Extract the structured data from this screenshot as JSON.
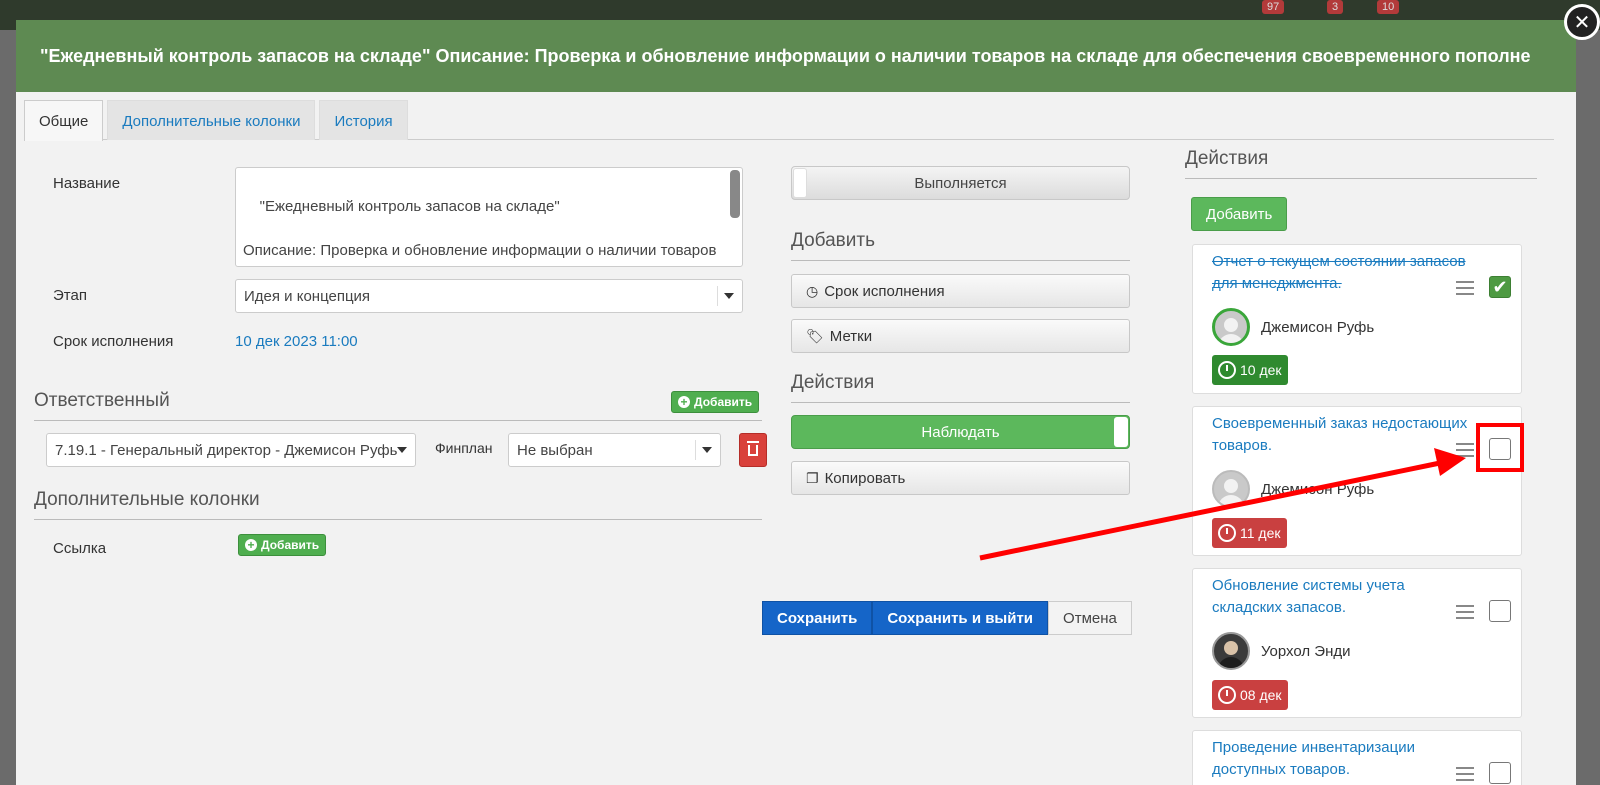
{
  "header": {
    "title": "\"Ежедневный контроль запасов на складе\" Описание: Проверка и обновление информации о наличии товаров на складе для обеспечения своевременного пополне"
  },
  "tabs": [
    {
      "label": "Общие",
      "active": true
    },
    {
      "label": "Дополнительные колонки",
      "active": false
    },
    {
      "label": "История",
      "active": false
    }
  ],
  "form": {
    "name_label": "Название",
    "name_value": "\"Ежедневный контроль запасов на складе\"\n\nОписание: Проверка и обновление информации о наличии товаров на складе для обеспечения своевременного пополнения",
    "stage_label": "Этап",
    "stage_value": "Идея и концепция",
    "deadline_label": "Срок исполнения",
    "deadline_value": "10 дек 2023 11:00"
  },
  "responsible": {
    "title": "Ответственный",
    "add_label": "Добавить",
    "person_value": "7.19.1 - Генеральный директор - Джемисон Руфь",
    "finplan_label": "Финплан",
    "finplan_value": "Не выбран"
  },
  "extra_columns": {
    "title": "Дополнительные колонки",
    "link_label": "Ссылка",
    "add_label": "Добавить"
  },
  "middle": {
    "status": "Выполняется",
    "add_title": "Добавить",
    "deadline_btn": "Срок исполнения",
    "tags_btn": "Метки",
    "actions_title": "Действия",
    "watch_btn": "Наблюдать",
    "copy_btn": "Копировать"
  },
  "footer": {
    "save": "Сохранить",
    "save_exit": "Сохранить и выйти",
    "cancel": "Отмена"
  },
  "actions_panel": {
    "title": "Действия",
    "add_label": "Добавить",
    "cards": [
      {
        "title": "Отчет о текущем состоянии запасов для менеджмента.",
        "done": true,
        "person": "Джемисон Руфь",
        "date": "10 дек",
        "date_color": "#2f8a2f"
      },
      {
        "title": "Своевременный заказ недостающих товаров.",
        "done": false,
        "person": "Джемисон Руфь",
        "date": "11 дек",
        "date_color": "#c94040"
      },
      {
        "title": "Обновление системы учета складских запасов.",
        "done": false,
        "person": "Уорхол Энди",
        "date": "08 дек",
        "date_color": "#c94040"
      },
      {
        "title": "Проведение инвентаризации доступных товаров.",
        "done": false
      }
    ]
  },
  "background": {
    "badges": [
      "97",
      "3",
      "10"
    ]
  },
  "colors": {
    "header": "#5e8a52",
    "accent_blue": "#1565c8",
    "green": "#5cb85c",
    "annotation": "#ff0000"
  }
}
